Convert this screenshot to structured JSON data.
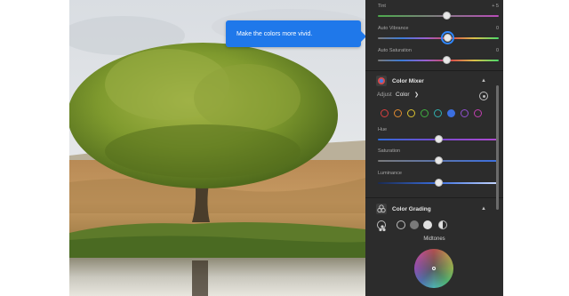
{
  "tooltip": {
    "text": "Make the colors more vivid."
  },
  "light_sliders": [
    {
      "label": "Tint",
      "value": "+ 5",
      "level": 0.57,
      "track": "linear-gradient(90deg,#4caa4c,#b84cb8)"
    },
    {
      "label": "Auto Vibrance",
      "value": "0",
      "level": 0.58,
      "track": "linear-gradient(90deg,#7a7a7a,#3b7bd9,#9b5fd0,#d94a4a,#d9c14a,#4ad96a)",
      "focused": true
    },
    {
      "label": "Auto Saturation",
      "value": "0",
      "level": 0.57,
      "track": "linear-gradient(90deg,#7a7a7a,#3b7bd9,#9b5fd0,#d94a4a,#d9c14a,#4ad96a)"
    }
  ],
  "color_mixer": {
    "title": "Color Mixer",
    "adjust_label": "Adjust",
    "adjust_value": "Color",
    "swatches": [
      {
        "name": "red",
        "color": "#d94040"
      },
      {
        "name": "orange",
        "color": "#e08a30"
      },
      {
        "name": "yellow",
        "color": "#d9c030"
      },
      {
        "name": "green",
        "color": "#40b040"
      },
      {
        "name": "aqua",
        "color": "#30b0b0"
      },
      {
        "name": "blue",
        "color": "#3b6fe0",
        "selected": true
      },
      {
        "name": "purple",
        "color": "#9050d0"
      },
      {
        "name": "magenta",
        "color": "#c040b0"
      }
    ],
    "sliders": [
      {
        "label": "Hue",
        "value": "0",
        "level": 0.5,
        "track": "linear-gradient(90deg,#2f6bd9,#7a4ad0,#b04ad0)"
      },
      {
        "label": "Saturation",
        "value": "0",
        "level": 0.5,
        "track": "linear-gradient(90deg,#7a7a7a,#3b6fe0)"
      },
      {
        "label": "Luminance",
        "value": "0",
        "level": 0.5,
        "track": "linear-gradient(90deg,#1a2a50,#3b6fe0,#c8d8ff)"
      }
    ]
  },
  "color_grading": {
    "title": "Color Grading",
    "midtones_label": "Midtones"
  },
  "colors": {
    "accent": "#1f78ea",
    "panel_bg": "#2c2c2c"
  }
}
